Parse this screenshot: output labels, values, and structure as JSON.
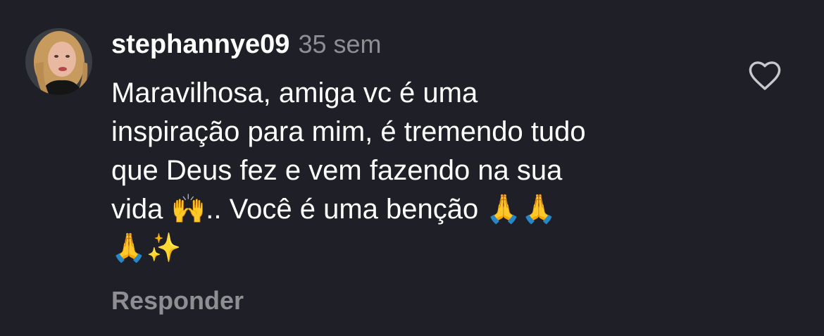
{
  "comment": {
    "username": "stephannye09",
    "time": "35 sem",
    "text": "Maravilhosa, amiga vc é uma\ninspiração para mim, é tremendo tudo\nque Deus fez e vem fazendo na sua\nvida 🙌.. Você é uma benção 🙏🙏\n🙏✨",
    "reply_label": "Responder",
    "avatar_icon": "user-avatar",
    "like_icon": "heart-outline-icon"
  },
  "colors": {
    "background": "#1f2027",
    "primary_text": "#ffffff",
    "secondary_text": "#8e8e93"
  }
}
